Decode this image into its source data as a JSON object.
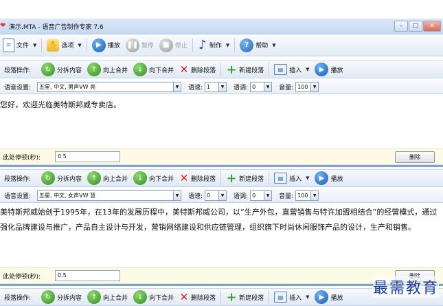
{
  "window": {
    "title": "演示.MTA - 语音广告制作专家 7.6",
    "controls": [
      "–",
      "□",
      "✕"
    ]
  },
  "toolbar": {
    "file": "文件",
    "options": "选项",
    "play": "播放",
    "pause": "暂停",
    "stop": "停止",
    "make": "制作",
    "help": "帮助"
  },
  "segment_toolbar": {
    "label": "段落操作:",
    "split": "分拆内容",
    "merge_up": "向上合并",
    "merge_down": "向下合并",
    "delete": "删除段落",
    "new": "新建段落",
    "insert": "插入",
    "play": "播放"
  },
  "voice_labels": {
    "voice": "语音设置:",
    "speed": "语速:",
    "pitch": "语调:",
    "volume": "音量:"
  },
  "pause_labels": {
    "label": "此处停顿(秒):",
    "delete": "删除"
  },
  "segments": [
    {
      "voice": "五星, 中文, 男声VW 亮",
      "speed": "1",
      "pitch": "0",
      "volume": "100",
      "text": "您好，欢迎光临美特斯邦威专卖店。",
      "pause": "0.5"
    },
    {
      "voice": "五星, 中文, 女声VW 慧",
      "speed": "0",
      "pitch": "0",
      "volume": "100",
      "text": "美特斯邦威始创于1995年，在13年的发展历程中，美特斯邦威公司，以“生产外包，直营销售与特许加盟相结合”的经营模式，通过强化品牌建设与推广，产品自主设计与开发，营销网络建设和供应链管理，组织旗下时尚休闲服饰产品的设计，生产和销售。",
      "pause": "0.5"
    }
  ],
  "watermark": "最需教育",
  "icons": {
    "file": "file-icon",
    "options": "options-icon",
    "play": "play-icon",
    "pause": "pause-icon",
    "stop": "stop-icon",
    "make": "music-note-icon",
    "help": "help-icon"
  }
}
